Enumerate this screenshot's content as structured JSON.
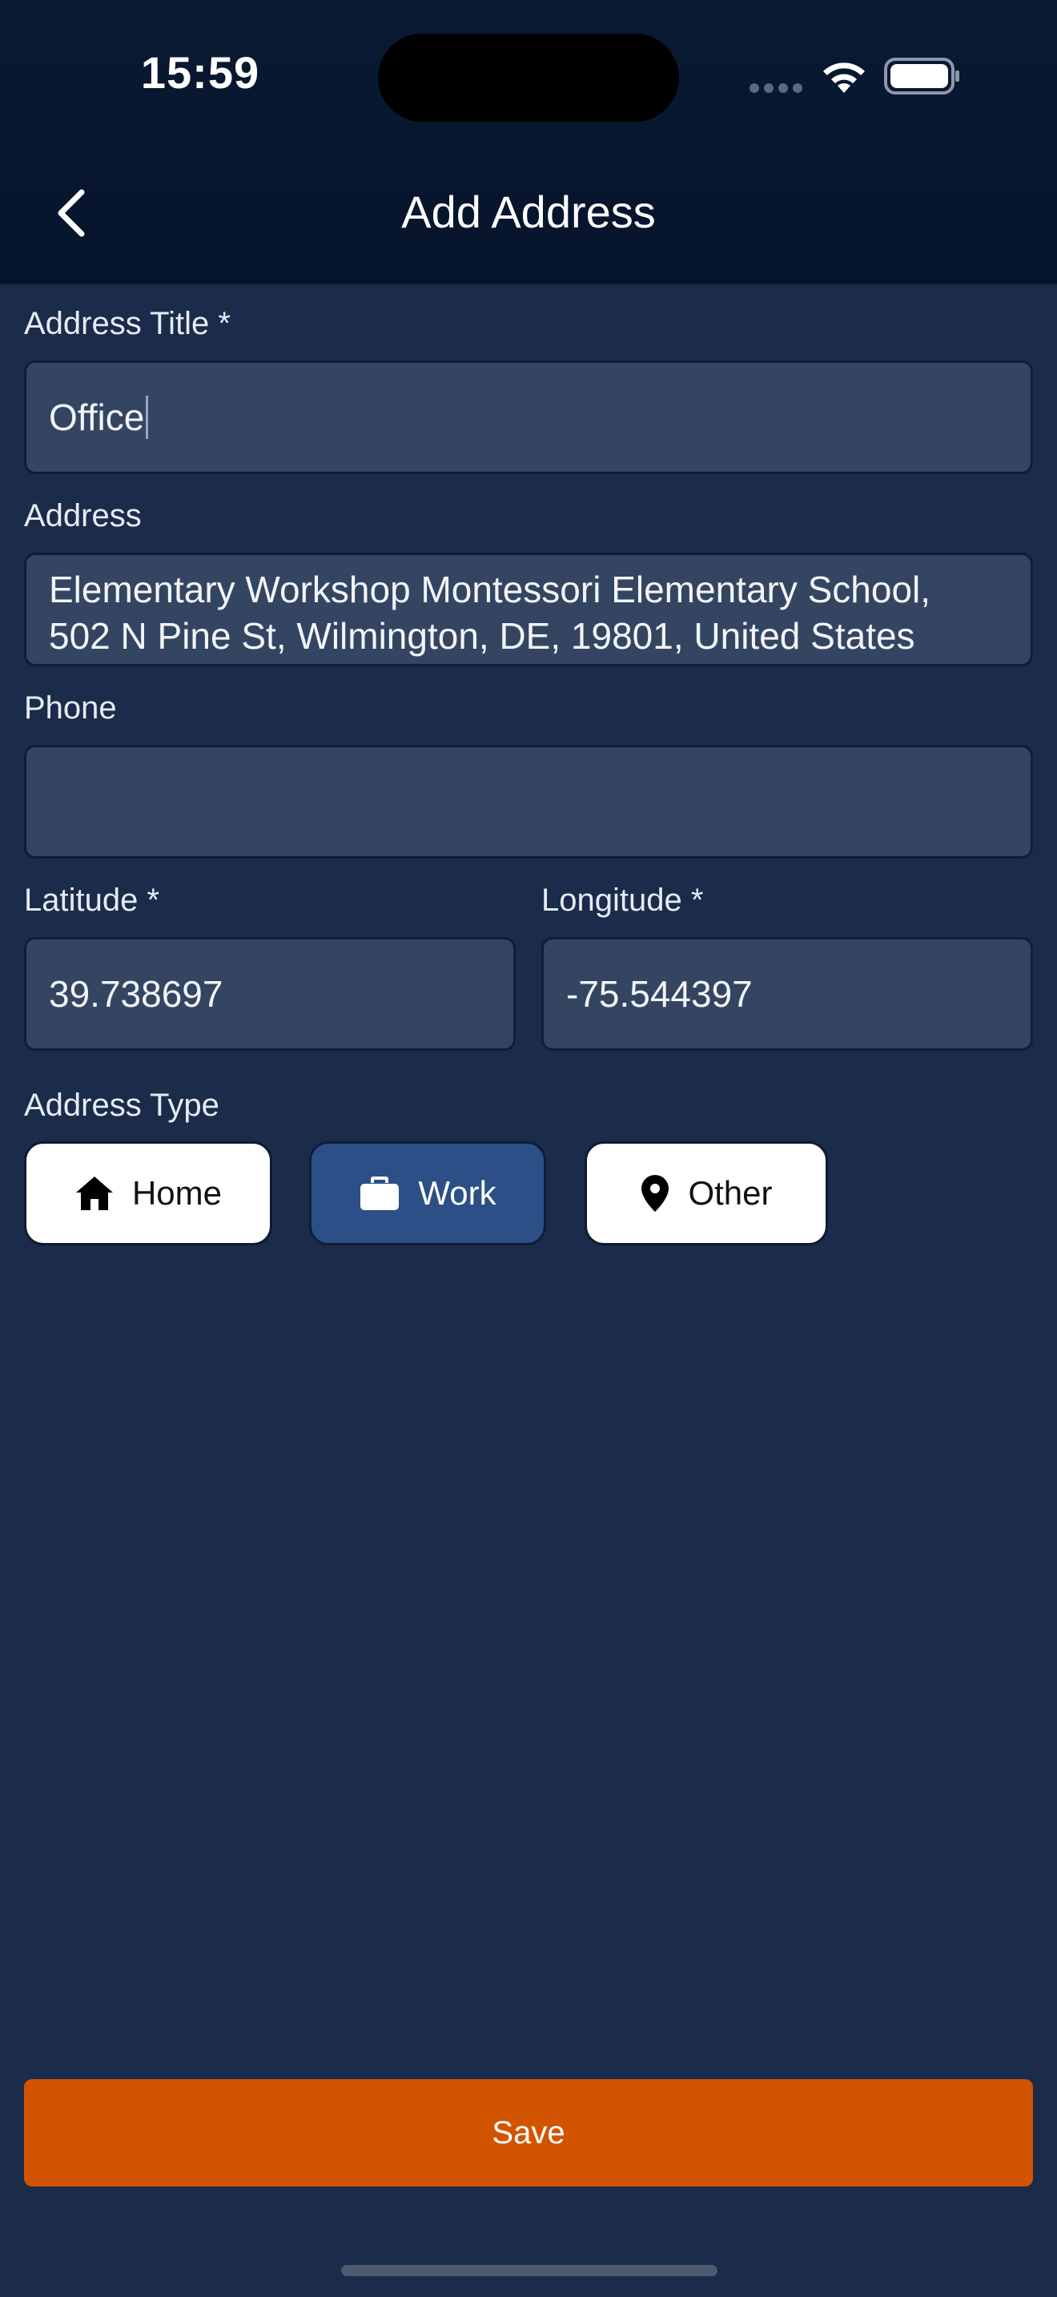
{
  "status_bar": {
    "time": "15:59"
  },
  "header": {
    "title": "Add Address",
    "back_icon": "chevron-left-icon"
  },
  "form": {
    "address_title": {
      "label": "Address Title *",
      "value": "Office"
    },
    "address": {
      "label": "Address",
      "value": "Elementary Workshop Montessori Elementary School,\n502 N Pine St, Wilmington, DE, 19801, United States"
    },
    "phone": {
      "label": "Phone",
      "value": ""
    },
    "latitude": {
      "label": "Latitude *",
      "value": "39.738697"
    },
    "longitude": {
      "label": "Longitude *",
      "value": "-75.544397"
    },
    "address_type": {
      "label": "Address Type",
      "options": [
        {
          "label": "Home",
          "icon": "home-icon",
          "selected": false
        },
        {
          "label": "Work",
          "icon": "briefcase-icon",
          "selected": true
        },
        {
          "label": "Other",
          "icon": "location-pin-icon",
          "selected": false
        }
      ]
    }
  },
  "actions": {
    "save_label": "Save"
  },
  "colors": {
    "background": "#1b2b4a",
    "header": "#06142c",
    "field": "#344562",
    "selected_chip": "#2b4f86",
    "save_button": "#d35400"
  }
}
